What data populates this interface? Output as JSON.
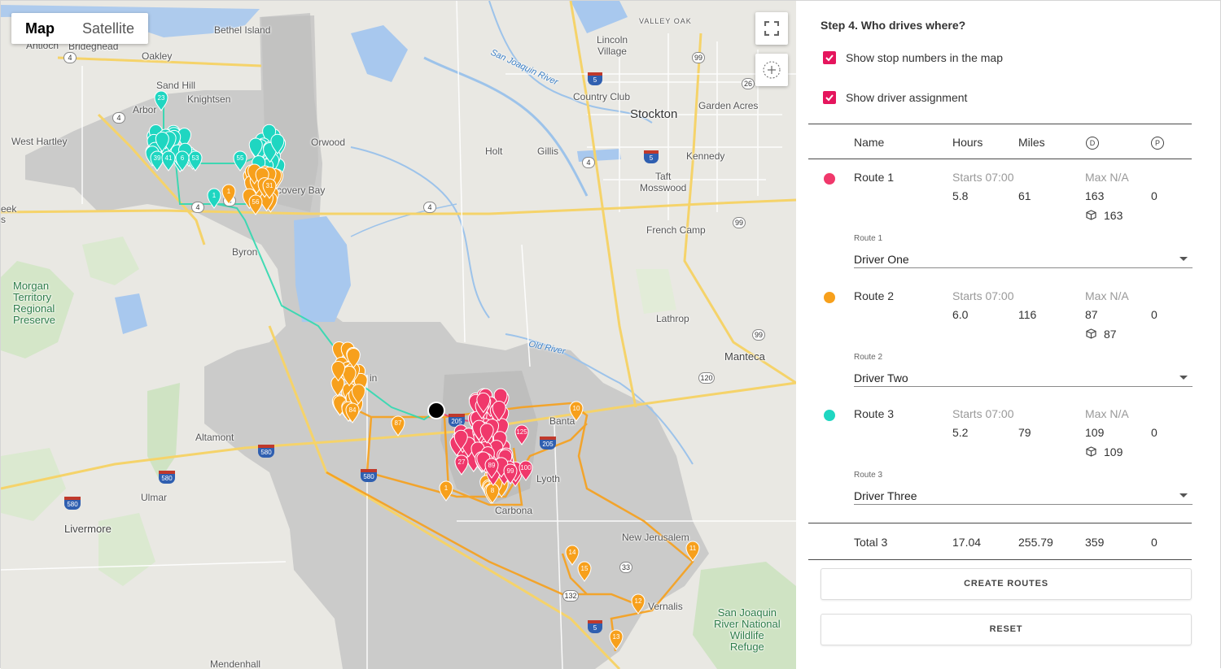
{
  "map": {
    "toggle": {
      "map_label": "Map",
      "satellite_label": "Satellite",
      "active": "Map"
    },
    "controls": {
      "fullscreen_icon": "fullscreen-icon",
      "locate_icon": "crosshair-icon"
    },
    "places": [
      {
        "id": "antioch",
        "text": "Antioch"
      },
      {
        "id": "brideghead",
        "text": "Brideghead"
      },
      {
        "id": "oakley",
        "text": "Oakley"
      },
      {
        "id": "bethel",
        "text": "Bethel Island"
      },
      {
        "id": "sandhill",
        "text": "Sand Hill"
      },
      {
        "id": "knightsen",
        "text": "Knightsen"
      },
      {
        "id": "arbor",
        "text": "Arbor"
      },
      {
        "id": "westhartley",
        "text": "West Hartley"
      },
      {
        "id": "orwood",
        "text": "Orwood"
      },
      {
        "id": "discovery",
        "text": "covery Bay"
      },
      {
        "id": "eek",
        "text": "eek"
      },
      {
        "id": "s",
        "text": "s"
      },
      {
        "id": "byron",
        "text": "Byron"
      },
      {
        "id": "morgan",
        "text": "Morgan\nTerritory\nRegional\nPreserve"
      },
      {
        "id": "valleyoak",
        "text": "VALLEY OAK"
      },
      {
        "id": "lincoln",
        "text": "Lincoln\nVillage"
      },
      {
        "id": "sjriver",
        "text": "San Joaquin River"
      },
      {
        "id": "countryclub",
        "text": "Country Club"
      },
      {
        "id": "stockton",
        "text": "Stockton"
      },
      {
        "id": "gardenacres",
        "text": "Garden Acres"
      },
      {
        "id": "holt",
        "text": "Holt"
      },
      {
        "id": "gillis",
        "text": "Gillis"
      },
      {
        "id": "kennedy",
        "text": "Kennedy"
      },
      {
        "id": "taft",
        "text": "Taft\nMosswood"
      },
      {
        "id": "frenchcamp",
        "text": "French Camp"
      },
      {
        "id": "lathrop",
        "text": "Lathrop"
      },
      {
        "id": "manteca",
        "text": "Manteca"
      },
      {
        "id": "oldriver",
        "text": "Old River"
      },
      {
        "id": "in",
        "text": "in"
      },
      {
        "id": "banta",
        "text": "Banta"
      },
      {
        "id": "altamont",
        "text": "Altamont"
      },
      {
        "id": "lyoth",
        "text": "Lyoth"
      },
      {
        "id": "carbona",
        "text": "Carbona"
      },
      {
        "id": "ulmar",
        "text": "Ulmar"
      },
      {
        "id": "livermore",
        "text": "Livermore"
      },
      {
        "id": "newjerusalem",
        "text": "New Jerusalem"
      },
      {
        "id": "vernalis",
        "text": "Vernalis"
      },
      {
        "id": "sjrefuge",
        "text": "San Joaquin\nRiver National\nWildlife\nRefuge"
      },
      {
        "id": "mendenhall",
        "text": "Mendenhall"
      }
    ],
    "shields": [
      "4",
      "4",
      "4",
      "4",
      "4",
      "4",
      "99",
      "99",
      "99",
      "26",
      "120",
      "132",
      "33"
    ],
    "interstates": [
      "5",
      "5",
      "5",
      "580",
      "580",
      "580",
      "580",
      "205",
      "205"
    ],
    "pin_labels": {
      "teal": [
        "23",
        "39",
        "41",
        "6",
        "53",
        "55",
        "1"
      ],
      "orange": [
        "1",
        "56",
        "31",
        "84",
        "87",
        "10",
        "1",
        "8",
        "14",
        "15",
        "11",
        "12",
        "13"
      ],
      "pink": [
        "27",
        "89",
        "99",
        "100",
        "125"
      ]
    },
    "colors": {
      "route1": "#f0386b",
      "route2": "#f7a01c",
      "route3": "#1fd6c1"
    }
  },
  "panel": {
    "step_title": "Step 4. Who drives where?",
    "checkbox_stops": "Show stop numbers in the map",
    "checkbox_drivers": "Show driver assignment",
    "headers": {
      "name": "Name",
      "hours": "Hours",
      "miles": "Miles",
      "d_icon": "D",
      "p_icon": "P"
    },
    "routes": [
      {
        "name": "Route 1",
        "starts": "Starts 07:00",
        "hours": "5.8",
        "miles": "61",
        "max": "Max N/A",
        "d": "163",
        "p": "0",
        "packages": "163",
        "select_label": "Route 1",
        "driver": "Driver One",
        "color": "#f0386b"
      },
      {
        "name": "Route 2",
        "starts": "Starts 07:00",
        "hours": "6.0",
        "miles": "116",
        "max": "Max N/A",
        "d": "87",
        "p": "0",
        "packages": "87",
        "select_label": "Route 2",
        "driver": "Driver Two",
        "color": "#f7a01c"
      },
      {
        "name": "Route 3",
        "starts": "Starts 07:00",
        "hours": "5.2",
        "miles": "79",
        "max": "Max N/A",
        "d": "109",
        "p": "0",
        "packages": "109",
        "select_label": "Route 3",
        "driver": "Driver Three",
        "color": "#1fd6c1"
      }
    ],
    "total": {
      "label": "Total 3",
      "hours": "17.04",
      "miles": "255.79",
      "d": "359",
      "p": "0"
    },
    "create_button": "CREATE ROUTES",
    "reset_button": "RESET"
  }
}
